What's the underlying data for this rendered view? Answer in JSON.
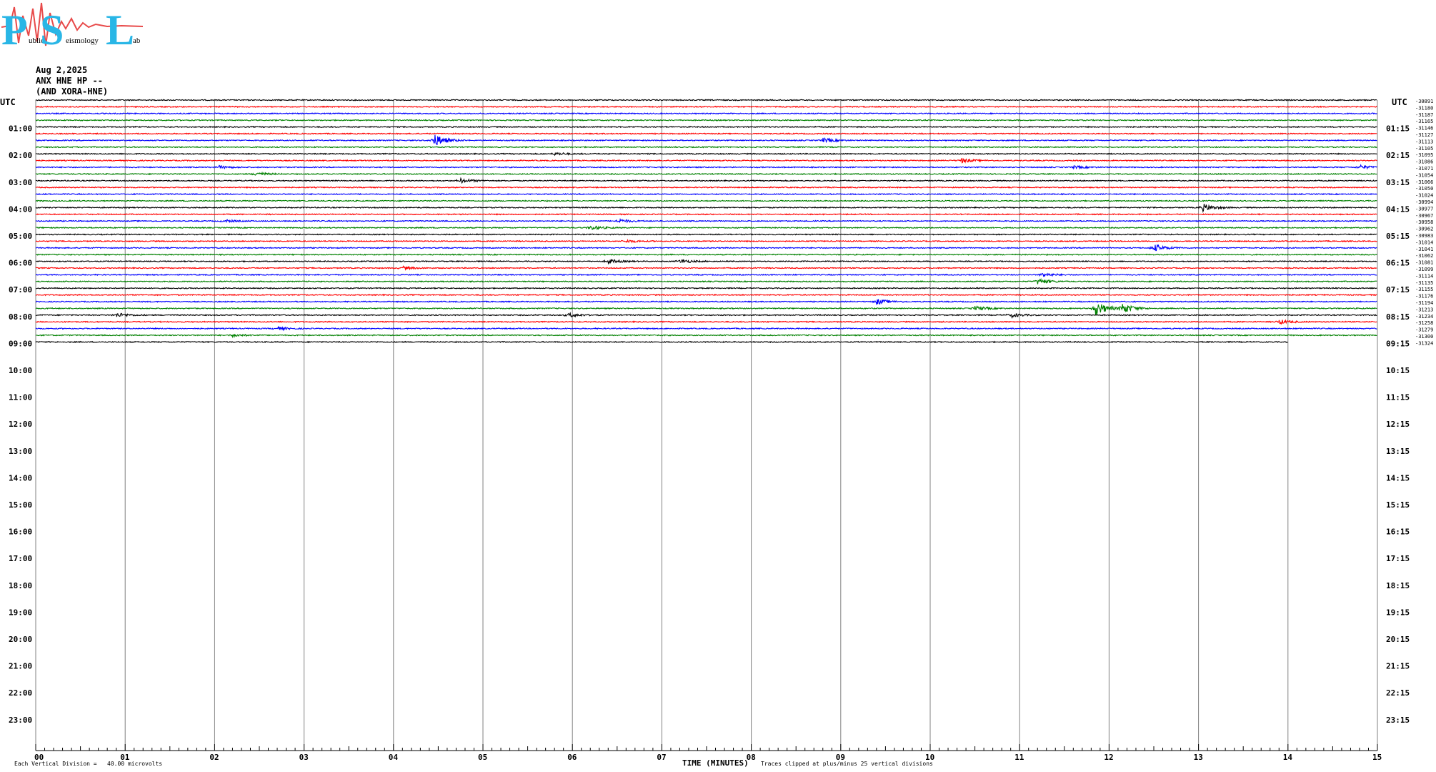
{
  "logo": {
    "letters": [
      "P",
      "S",
      "L"
    ],
    "subtext": [
      "ublic",
      "eismology",
      "ab"
    ],
    "colors": {
      "letters": "#29b6e6",
      "wave": "#e84a4a"
    }
  },
  "header": {
    "date": "Aug 2,2025",
    "station": "ANX HNE HP --",
    "source": "(AND XORA-HNE)"
  },
  "colors": {
    "trace_cycle": [
      "#000000",
      "#ff0000",
      "#0000ff",
      "#008000"
    ],
    "grid": "#808080",
    "text": "#000000"
  },
  "chart_data": {
    "type": "helicorder",
    "left_axis_title": "UTC",
    "right_axis_title": "UTC",
    "left_hour_labels": [
      "01:00",
      "02:00",
      "03:00",
      "04:00",
      "05:00",
      "06:00",
      "07:00",
      "08:00",
      "09:00",
      "10:00",
      "11:00",
      "12:00",
      "13:00",
      "14:00",
      "15:00",
      "16:00",
      "17:00",
      "18:00",
      "19:00",
      "20:00",
      "21:00",
      "22:00",
      "23:00"
    ],
    "right_hour_labels": [
      "01:15",
      "02:15",
      "03:15",
      "04:15",
      "05:15",
      "06:15",
      "07:15",
      "08:15",
      "09:15",
      "10:15",
      "11:15",
      "12:15",
      "13:15",
      "14:15",
      "15:15",
      "16:15",
      "17:15",
      "18:15",
      "19:15",
      "20:15",
      "21:15",
      "22:15",
      "23:15"
    ],
    "x_tick_labels": [
      "00",
      "01",
      "02",
      "03",
      "04",
      "05",
      "06",
      "07",
      "08",
      "09",
      "10",
      "11",
      "12",
      "13",
      "14",
      "15"
    ],
    "x_range_minutes": [
      0,
      15
    ],
    "minutes_per_line": 15,
    "lines_per_hour": 4,
    "xlabel": "TIME (MINUTES)",
    "scale_note": "Each Vertical Division =   40.00 microvolts",
    "clip_note": "Traces clipped at plus/minus 25 vertical divisions",
    "trace_offsets": [
      "-30891",
      "-31180",
      "-31187",
      "-31165",
      "-31146",
      "-31127",
      "-31113",
      "-31105",
      "-31095",
      "-31086",
      "-31071",
      "-31054",
      "-31066",
      "-31050",
      "-31024",
      "-30994",
      "-30977",
      "-30967",
      "-30958",
      "-30962",
      "-30983",
      "-31014",
      "-31041",
      "-31062",
      "-31081",
      "-31099",
      "-31114",
      "-31135",
      "-31155",
      "-31176",
      "-31194",
      "-31213",
      "-31234",
      "-31258",
      "-31279",
      "-31300",
      "-31324"
    ],
    "trace_count": 37,
    "last_trace_end_minute": 14.0,
    "events": [
      {
        "line": 6,
        "minute": 4.45,
        "amp": 9
      },
      {
        "line": 6,
        "minute": 8.8,
        "amp": 3
      },
      {
        "line": 8,
        "minute": 5.8,
        "amp": 2
      },
      {
        "line": 9,
        "minute": 10.35,
        "amp": 3
      },
      {
        "line": 10,
        "minute": 2.05,
        "amp": 2
      },
      {
        "line": 10,
        "minute": 11.6,
        "amp": 2
      },
      {
        "line": 10,
        "minute": 14.8,
        "amp": 3
      },
      {
        "line": 11,
        "minute": 2.45,
        "amp": 3
      },
      {
        "line": 12,
        "minute": 4.75,
        "amp": 3
      },
      {
        "line": 16,
        "minute": 13.05,
        "amp": 5
      },
      {
        "line": 18,
        "minute": 2.1,
        "amp": 2
      },
      {
        "line": 18,
        "minute": 6.5,
        "amp": 3
      },
      {
        "line": 19,
        "minute": 6.2,
        "amp": 3
      },
      {
        "line": 21,
        "minute": 6.6,
        "amp": 2
      },
      {
        "line": 22,
        "minute": 12.5,
        "amp": 5
      },
      {
        "line": 24,
        "minute": 6.4,
        "amp": 3
      },
      {
        "line": 24,
        "minute": 7.2,
        "amp": 3
      },
      {
        "line": 25,
        "minute": 4.1,
        "amp": 2
      },
      {
        "line": 26,
        "minute": 11.25,
        "amp": 3
      },
      {
        "line": 27,
        "minute": 11.2,
        "amp": 4
      },
      {
        "line": 30,
        "minute": 9.4,
        "amp": 4
      },
      {
        "line": 31,
        "minute": 10.5,
        "amp": 3
      },
      {
        "line": 31,
        "minute": 11.85,
        "amp": 10
      },
      {
        "line": 31,
        "minute": 12.15,
        "amp": 7
      },
      {
        "line": 32,
        "minute": 0.9,
        "amp": 3
      },
      {
        "line": 32,
        "minute": 5.95,
        "amp": 3
      },
      {
        "line": 32,
        "minute": 10.9,
        "amp": 3
      },
      {
        "line": 33,
        "minute": 13.9,
        "amp": 3
      },
      {
        "line": 34,
        "minute": 2.7,
        "amp": 2
      },
      {
        "line": 35,
        "minute": 2.2,
        "amp": 2
      }
    ]
  }
}
